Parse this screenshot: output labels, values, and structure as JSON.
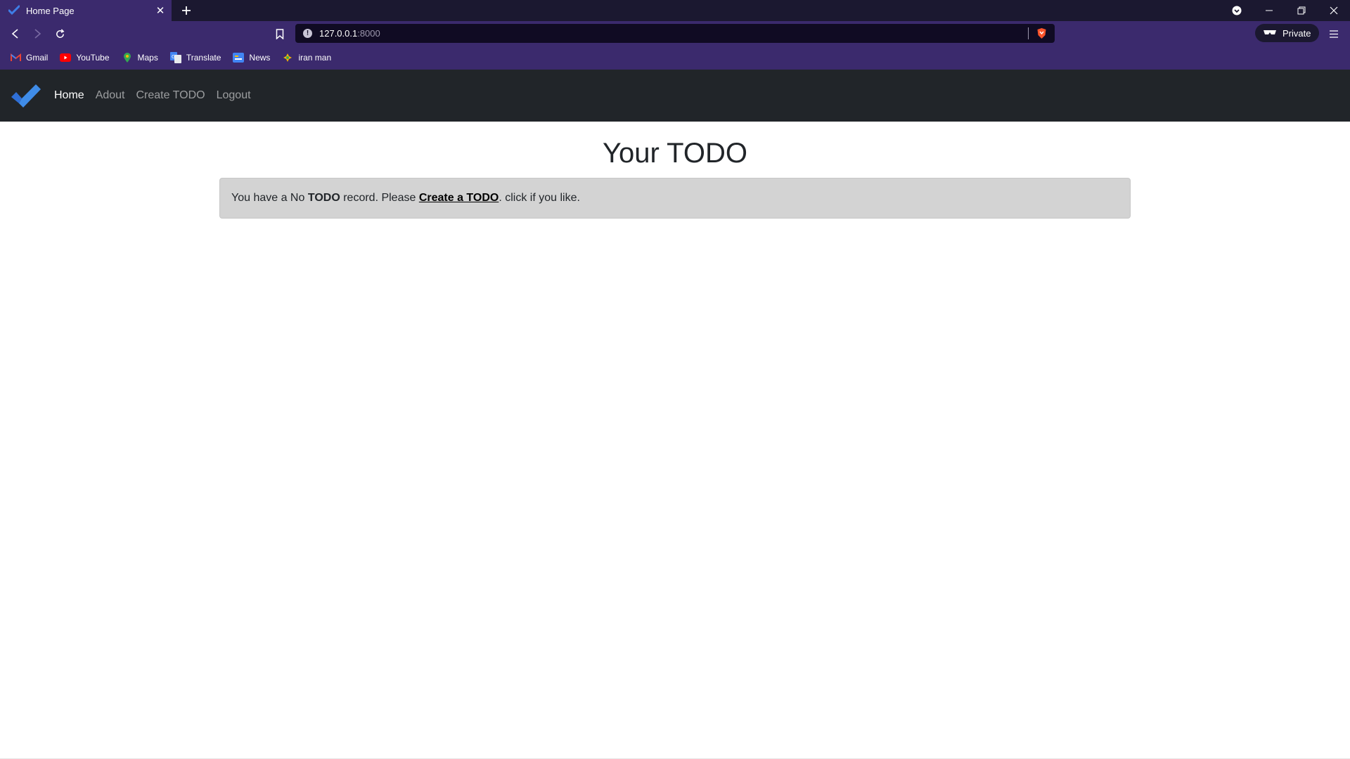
{
  "browser": {
    "tab": {
      "title": "Home Page"
    },
    "address": {
      "host": "127.0.0.1",
      "port": ":8000"
    },
    "private_label": "Private",
    "bookmarks": [
      {
        "label": "Gmail",
        "icon": "gmail-icon"
      },
      {
        "label": "YouTube",
        "icon": "youtube-icon"
      },
      {
        "label": "Maps",
        "icon": "maps-icon"
      },
      {
        "label": "Translate",
        "icon": "translate-icon"
      },
      {
        "label": "News",
        "icon": "news-icon"
      },
      {
        "label": "iran man",
        "icon": "bookmark-favicon"
      }
    ]
  },
  "site": {
    "nav": {
      "items": [
        {
          "label": "Home",
          "active": true
        },
        {
          "label": "Adout"
        },
        {
          "label": "Create TODO"
        },
        {
          "label": "Logout"
        }
      ]
    },
    "title": "Your TODO",
    "alert": {
      "text1": "You have a No ",
      "bold": "TODO",
      "text2": " record. Please ",
      "link": "Create a TODO",
      "text3": ". click if you like."
    }
  },
  "colors": {
    "chrome_purple": "#3b2a6d",
    "tabbar_dark": "#1b1830",
    "navbar": "#212529",
    "alert_bg": "#d3d3d3",
    "logo_blue": "#3f7ee6"
  }
}
